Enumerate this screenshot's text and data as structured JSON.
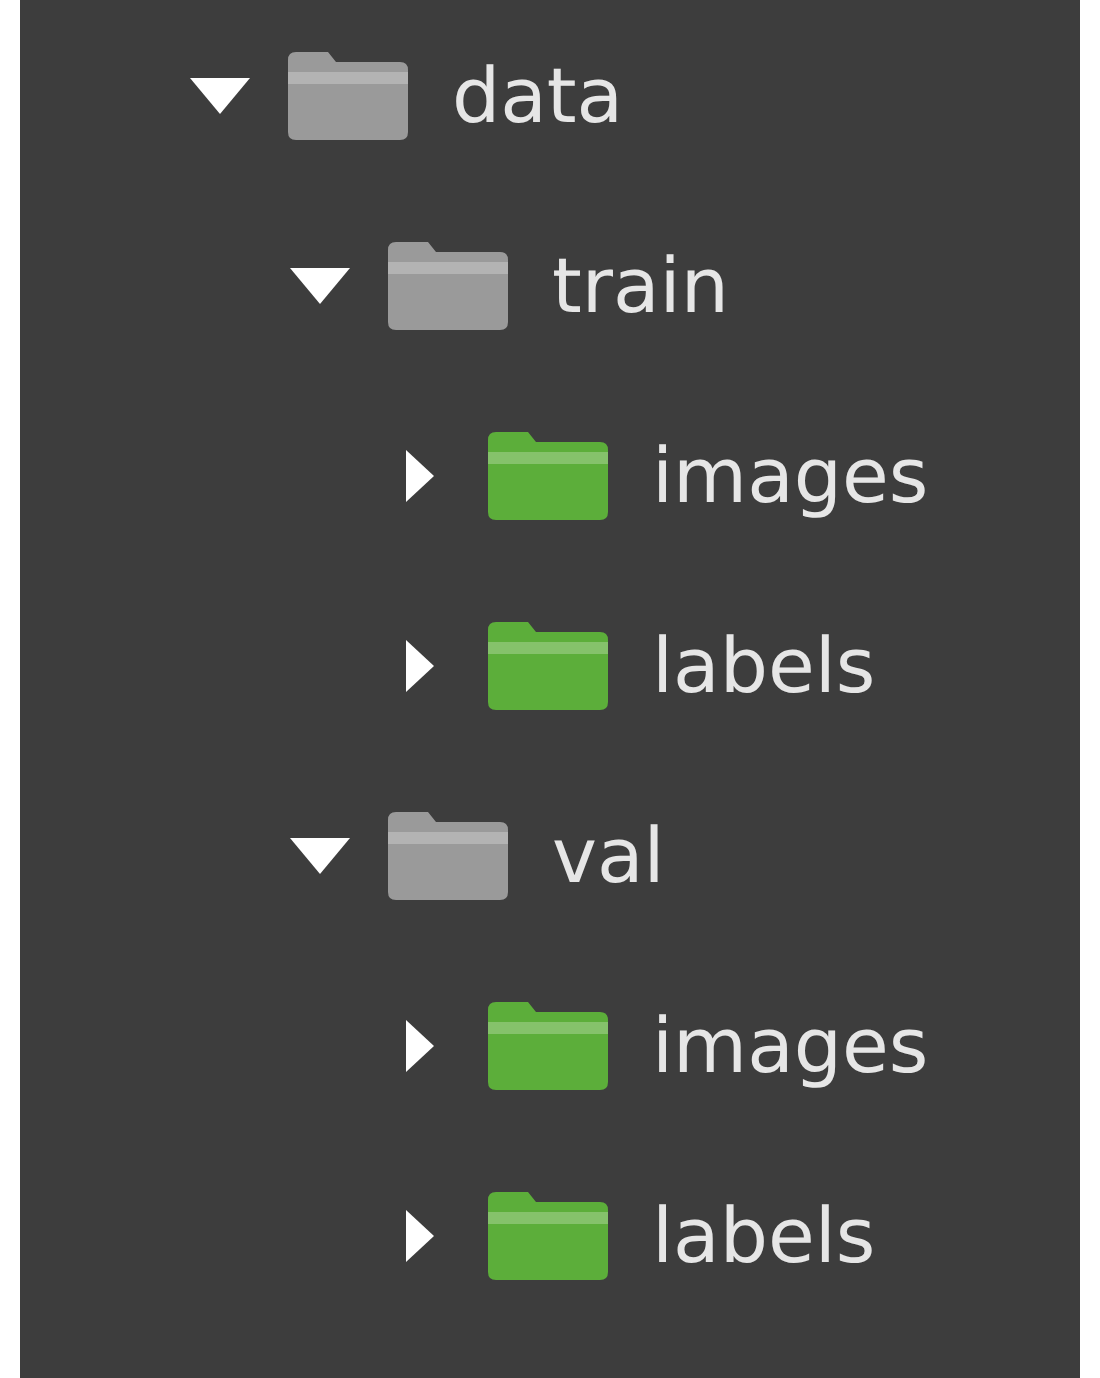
{
  "tree": [
    {
      "name": "data",
      "expanded": true,
      "color": "#9a9a9a",
      "children": [
        {
          "name": "train",
          "expanded": true,
          "color": "#9a9a9a",
          "children": [
            {
              "name": "images",
              "expanded": false,
              "color": "#5cae3a"
            },
            {
              "name": "labels",
              "expanded": false,
              "color": "#5cae3a"
            }
          ]
        },
        {
          "name": "val",
          "expanded": true,
          "color": "#9a9a9a",
          "children": [
            {
              "name": "images",
              "expanded": false,
              "color": "#5cae3a"
            },
            {
              "name": "labels",
              "expanded": false,
              "color": "#5cae3a"
            }
          ]
        }
      ]
    }
  ]
}
